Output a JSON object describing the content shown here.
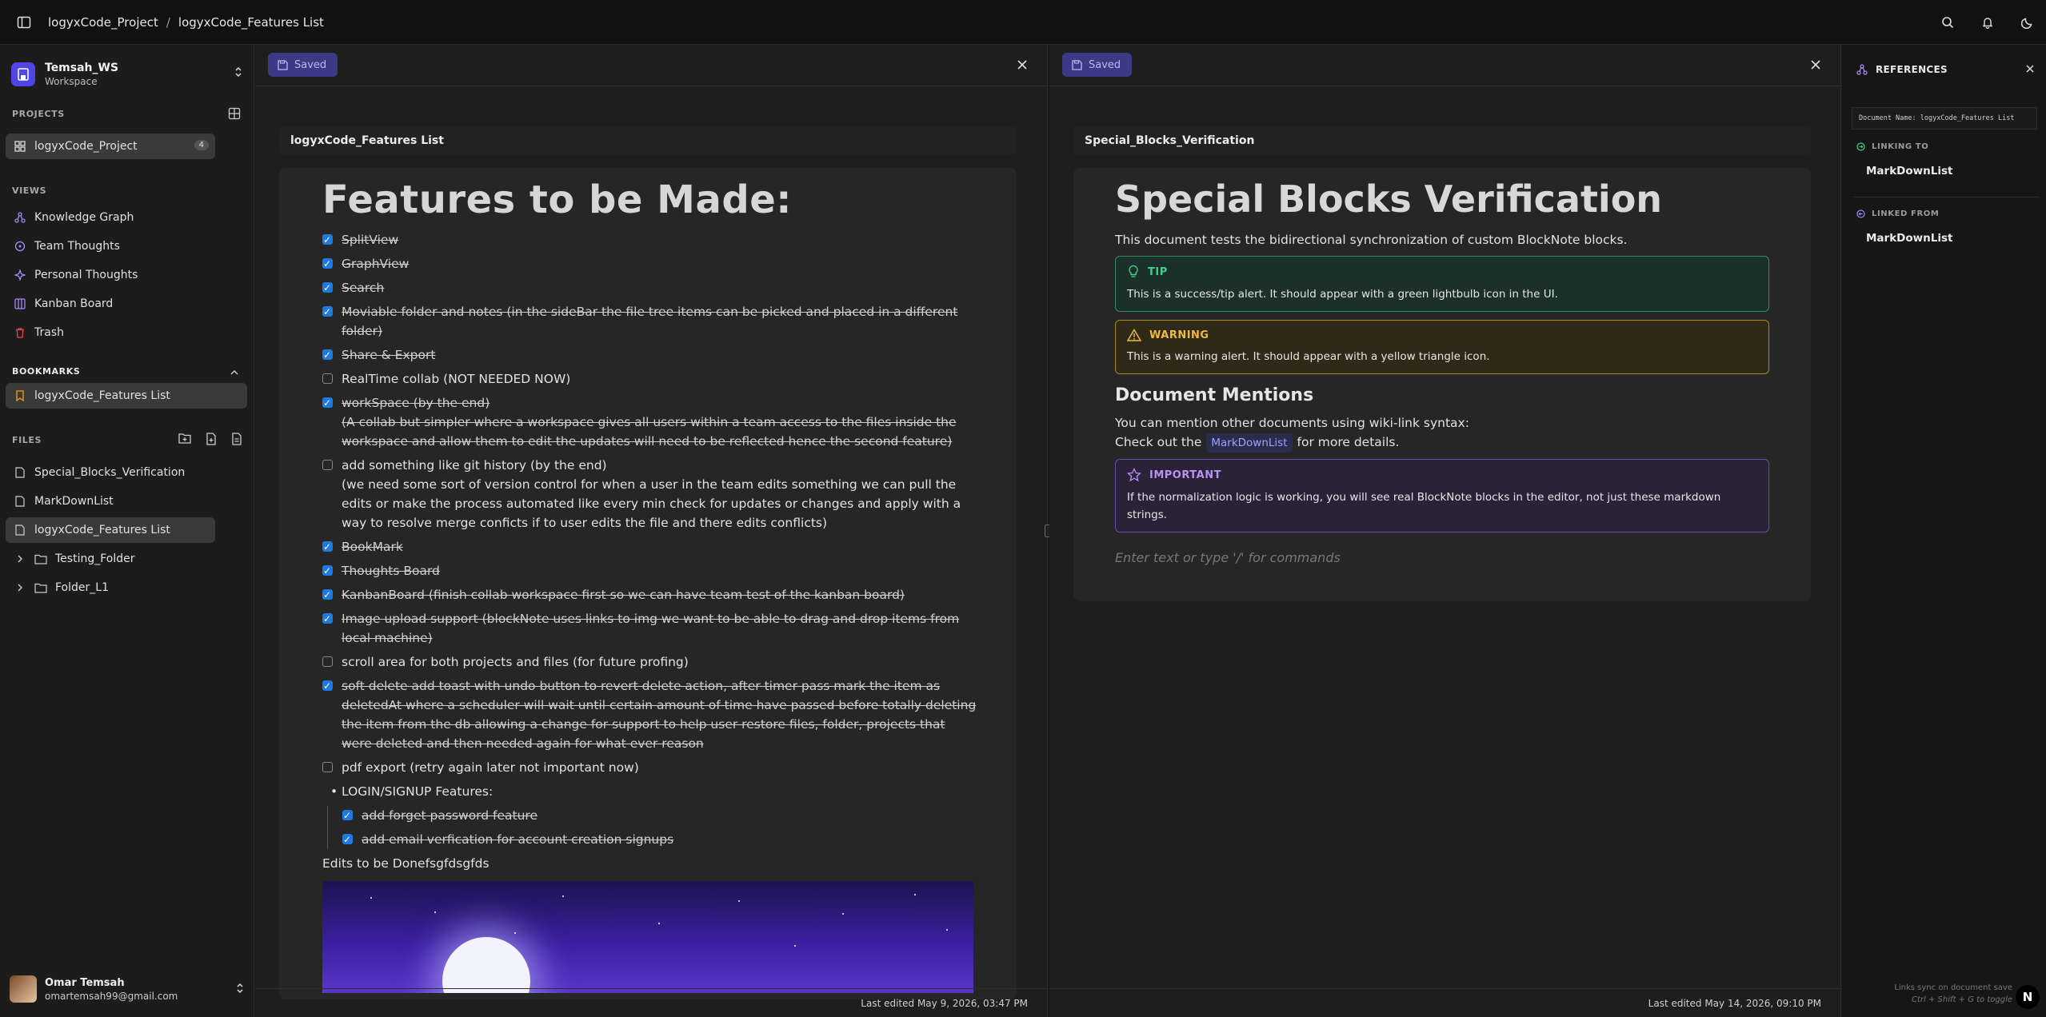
{
  "topbar": {
    "breadcrumb": [
      "logyxCode_Project",
      "logyxCode_Features List"
    ],
    "separator": "/"
  },
  "workspace": {
    "name": "Temsah_WS",
    "subtitle": "Workspace"
  },
  "sections": {
    "projects": "PROJECTS",
    "views": "VIEWS",
    "bookmarks": "BOOKMARKS",
    "files": "FILES"
  },
  "projects": [
    {
      "label": "logyxCode_Project",
      "count": "4"
    }
  ],
  "views": [
    {
      "label": "Knowledge Graph",
      "icon": "graph-icon",
      "color": "#a78bfa"
    },
    {
      "label": "Team Thoughts",
      "icon": "circle-icon",
      "color": "#a78bfa"
    },
    {
      "label": "Personal Thoughts",
      "icon": "sparkle-icon",
      "color": "#a78bfa"
    },
    {
      "label": "Kanban Board",
      "icon": "board-icon",
      "color": "#a78bfa"
    },
    {
      "label": "Trash",
      "icon": "trash-icon",
      "color": "#ef4444"
    }
  ],
  "bookmarks": [
    {
      "label": "logyxCode_Features List"
    }
  ],
  "files": [
    {
      "label": "Special_Blocks_Verification",
      "type": "file"
    },
    {
      "label": "MarkDownList",
      "type": "file"
    },
    {
      "label": "logyxCode_Features List",
      "type": "file"
    },
    {
      "label": "Testing_Folder",
      "type": "folder"
    },
    {
      "label": "Folder_L1",
      "type": "folder"
    }
  ],
  "user": {
    "name": "Omar Temsah",
    "email": "omartemsah99@gmail.com"
  },
  "left_pane": {
    "saved": "Saved",
    "doc_title": "logyxCode_Features List",
    "heading": "Features to be Made:",
    "tasks": [
      {
        "text": "SplitView",
        "done": true
      },
      {
        "text": "GraphView",
        "done": true
      },
      {
        "text": "Search",
        "done": true
      },
      {
        "text": "Moviable folder and notes (in the sideBar the file tree items can be picked and placed in a different folder)",
        "done": true
      },
      {
        "text": "Share & Export",
        "done": true
      },
      {
        "text": "RealTime collab (NOT NEEDED NOW)",
        "done": false
      },
      {
        "text": "workSpace (by the end)",
        "done": true,
        "extra": "(A collab but simpler where a workspace gives all users within a team access to the files inside the workspace and allow them to edit the updates will need to be reflected hence the second feature)"
      },
      {
        "text": "add something like git history (by the end)",
        "done": false,
        "extra": "(we need some sort of version control for when a user in the team edits something we can pull the edits or make the process automated like every min check for updates or changes and apply with a way to resolve merge conficts if to user edits the file and there edits conflicts)"
      },
      {
        "text": "BookMark",
        "done": true
      },
      {
        "text": "Thoughts Board",
        "done": true
      },
      {
        "text": "KanbanBoard (finish collab workspace first so we can have team test of the kanban board)",
        "done": true
      },
      {
        "text": "Image upload support (blockNote uses links to img we want to be able to drag and drop items from local machine)",
        "done": true
      },
      {
        "text": "scroll area for both projects and files (for future profing)",
        "done": false
      },
      {
        "text": "soft delete add toast with undo button to revert delete action, after timer pass mark the item as deletedAt where a scheduler will wait until certain amount of time have passed before totally deleting the item from the db allowing a change for support to help user restore files, folder, projects that were deleted and then needed again for what ever reason",
        "done": true
      },
      {
        "text": "pdf export (retry again later not important now)",
        "done": false
      }
    ],
    "bullet": "LOGIN/SIGNUP Features:",
    "sub_tasks": [
      {
        "text": "add forget password feature",
        "done": true
      },
      {
        "text": "add email verfication for account creation signups",
        "done": true
      }
    ],
    "trailing": "Edits to be Donefsgfdsgfds",
    "footer": "Last edited May 9, 2026, 03:47 PM"
  },
  "right_pane": {
    "saved": "Saved",
    "doc_title": "Special_Blocks_Verification",
    "heading": "Special Blocks Verification",
    "intro": "This document tests the bidirectional synchronization of custom BlockNote blocks.",
    "tip": {
      "title": "TIP",
      "body": "This is a success/tip alert. It should appear with a green lightbulb icon in the UI."
    },
    "warning": {
      "title": "WARNING",
      "body": "This is a warning alert. It should appear with a yellow triangle icon."
    },
    "mentions_heading": "Document Mentions",
    "mentions_line1": "You can mention other documents using wiki-link syntax:",
    "mentions_pre": "Check out the",
    "mentions_link": "MarkDownList",
    "mentions_post": "for more details.",
    "important": {
      "title": "IMPORTANT",
      "body": "If the normalization logic is working, you will see real BlockNote blocks in the editor, not just these markdown strings."
    },
    "placeholder": "Enter text or type '/' for commands",
    "footer": "Last edited May 14, 2026, 09:10 PM"
  },
  "references": {
    "title": "REFERENCES",
    "doc_name": "Document Name: logyxCode_Features List",
    "linking_to_label": "LINKING TO",
    "linking_to": "MarkDownList",
    "linked_from_label": "LINKED FROM",
    "linked_from": "MarkDownList",
    "footer_line1": "Links sync on document save",
    "footer_line2": "Ctrl + Shift + G to toggle",
    "n_button": "N"
  },
  "colors": {
    "accent": "#4f46e5",
    "saved_bg": "#3b3a86",
    "checkbox": "#1f7ae0"
  }
}
